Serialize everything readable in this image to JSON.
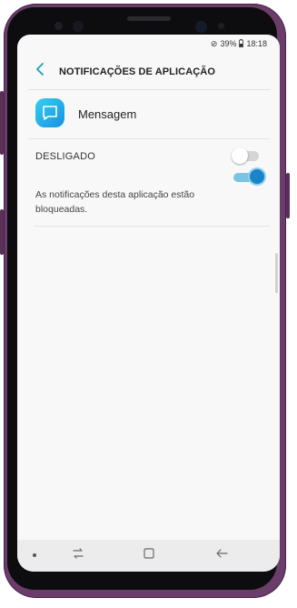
{
  "status_bar": {
    "no_sim_icon": "blocked-circle-icon",
    "battery_percent": "39%",
    "battery_icon": "battery-icon",
    "time": "18:18"
  },
  "app_bar": {
    "back_icon": "chevron-left-icon",
    "title": "NOTIFICAÇÕES DE APLICAÇÃO"
  },
  "app": {
    "name": "Mensagem",
    "icon": "message-bubble-icon"
  },
  "setting": {
    "label": "DESLIGADO",
    "toggle_state": "off"
  },
  "description": "As notificações desta aplicação estão bloqueadas.",
  "nav_bar": {
    "recents_icon": "recents-icon",
    "home_icon": "home-icon",
    "back_icon": "back-arrow-icon"
  },
  "colors": {
    "accent": "#1f9bbf",
    "frame": "#6b3d6a",
    "toggle_off": "#d5d5d5"
  }
}
